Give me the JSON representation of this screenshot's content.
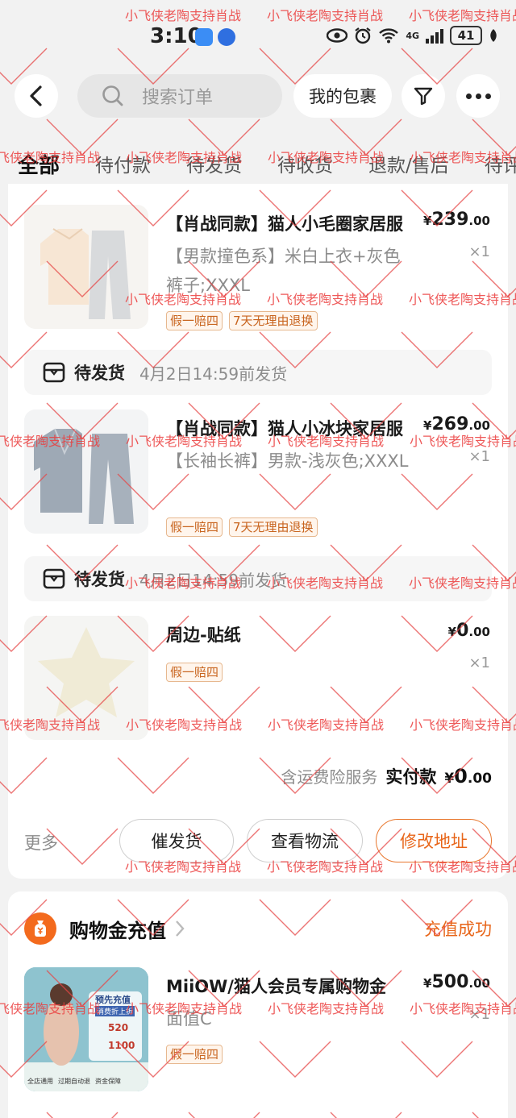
{
  "status_bar": {
    "time": "3:10",
    "network": "4G",
    "battery": "41"
  },
  "header": {
    "search_placeholder": "搜索订单",
    "my_packages": "我的包裹"
  },
  "tabs": [
    "全部",
    "待付款",
    "待发货",
    "待收货",
    "退款/售后",
    "待评价"
  ],
  "order": {
    "items": [
      {
        "title": "【肖战同款】猫人小毛圈家居服",
        "spec": "【男款撞色系】米白上衣+灰色裤子;XXXL",
        "price_int": "239",
        "price_dec": ".00",
        "qty": "×1",
        "tags": [
          "假一赔四",
          "7天无理由退换"
        ]
      },
      {
        "title": "【肖战同款】猫人小冰块家居服",
        "spec": "【长袖长裤】男款-浅灰色;XXXL",
        "price_int": "269",
        "price_dec": ".00",
        "qty": "×1",
        "tags": [
          "假一赔四",
          "7天无理由退换"
        ]
      },
      {
        "title": "周边-贴纸",
        "spec": "",
        "price_int": "0",
        "price_dec": ".00",
        "qty": "×1",
        "tags": [
          "假一赔四"
        ]
      }
    ],
    "packages": [
      {
        "status": "待发货",
        "time": "4月2日14:59前发货"
      },
      {
        "status": "待发货",
        "time": "4月2日14:59前发货"
      }
    ],
    "currency": "¥",
    "insurance_text": "含运费险服务",
    "paid_label": "实付款",
    "paid_int": "0",
    "paid_dec": ".00",
    "more_label": "更多",
    "buttons": {
      "urge": "催发货",
      "logistics": "查看物流",
      "change_address": "修改地址"
    }
  },
  "recharge": {
    "title": "购物金充值",
    "status": "充值成功",
    "item": {
      "title": "MiiOW/猫人会员专属购物金",
      "spec": "面值C",
      "price_int": "500",
      "price_dec": ".00",
      "qty": "×1",
      "tags": [
        "假一赔四"
      ],
      "banner_heading": "预先充值",
      "banner_sub": "消费折上折",
      "banner_amount_1": "520",
      "banner_amount_2": "1100",
      "banner_footer": [
        "全店通用",
        "过期自动退",
        "资金保障"
      ]
    }
  },
  "watermark": "小飞侠老陶支持肖战",
  "colors": {
    "accent": "#e8661a",
    "tag": "#c8641e",
    "watermark": "#eb3c3c"
  }
}
